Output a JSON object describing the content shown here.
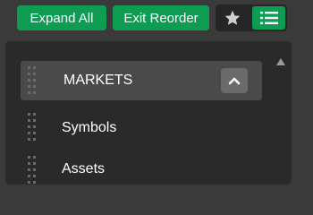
{
  "toolbar": {
    "expand_all_label": "Expand All",
    "exit_reorder_label": "Exit Reorder",
    "favorites_icon": "star-icon",
    "list_view_icon": "list-icon",
    "accent_color": "#0d9c52"
  },
  "panel": {
    "section": {
      "label": "MARKETS",
      "collapse_icon": "chevron-up-icon"
    },
    "items": [
      {
        "label": "Symbols"
      },
      {
        "label": "Assets"
      }
    ]
  }
}
